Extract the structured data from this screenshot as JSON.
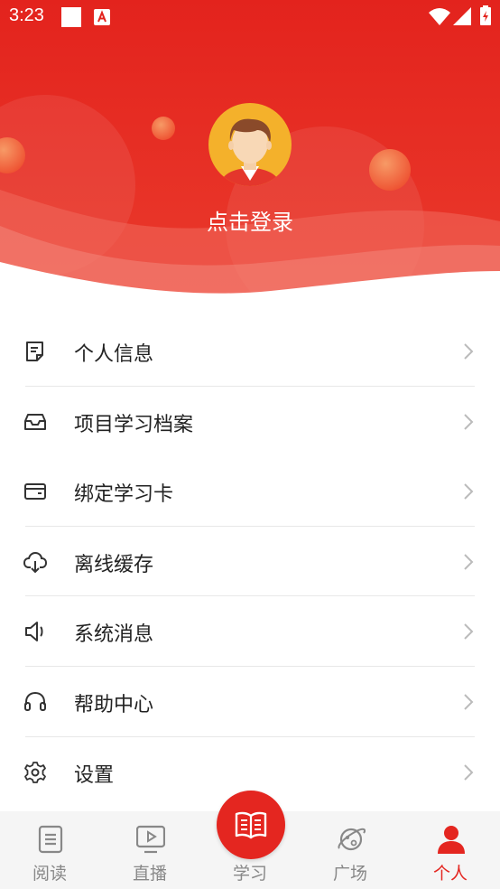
{
  "status_bar": {
    "time": "3:23"
  },
  "header": {
    "login_text": "点击登录"
  },
  "menu": {
    "items": [
      {
        "label": "个人信息",
        "icon": "document-icon"
      },
      {
        "label": "项目学习档案",
        "icon": "inbox-tray-icon"
      },
      {
        "label": "绑定学习卡",
        "icon": "card-icon"
      },
      {
        "label": "离线缓存",
        "icon": "cloud-download-icon"
      },
      {
        "label": "系统消息",
        "icon": "speaker-icon"
      },
      {
        "label": "帮助中心",
        "icon": "headset-icon"
      },
      {
        "label": "设置",
        "icon": "gear-icon"
      }
    ]
  },
  "tabbar": {
    "tabs": [
      {
        "label": "阅读",
        "icon": "reading-list-icon"
      },
      {
        "label": "直播",
        "icon": "tv-play-icon"
      },
      {
        "label": "学习",
        "icon": "open-book-icon"
      },
      {
        "label": "广场",
        "icon": "planet-icon"
      },
      {
        "label": "个人",
        "icon": "person-icon"
      }
    ],
    "active_index": 4
  },
  "colors": {
    "brand_red": "#e42620",
    "inactive_gray": "#888888",
    "header_red": "#e7261e"
  }
}
